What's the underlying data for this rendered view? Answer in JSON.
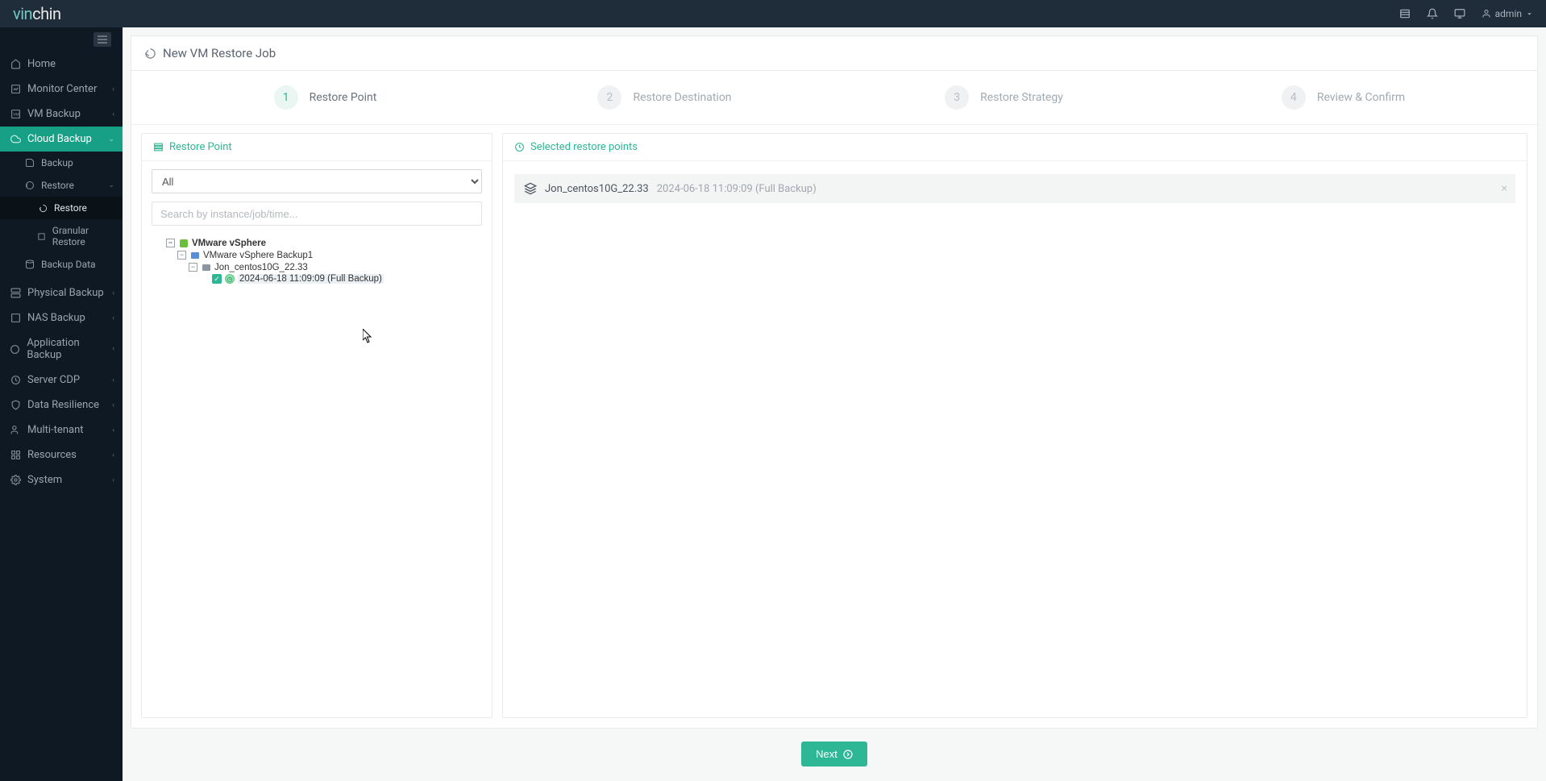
{
  "brand": {
    "p1": "vin",
    "p2": "chin"
  },
  "user": {
    "name": "admin"
  },
  "nav": {
    "home": "Home",
    "monitor": "Monitor Center",
    "vmbackup": "VM Backup",
    "cloudbackup": "Cloud Backup",
    "backup": "Backup",
    "restore": "Restore",
    "restore2": "Restore",
    "granular": "Granular Restore",
    "backupdata": "Backup Data",
    "physical": "Physical Backup",
    "nas": "NAS Backup",
    "app": "Application Backup",
    "cdp": "Server CDP",
    "resilience": "Data Resilience",
    "multitenant": "Multi-tenant",
    "resources": "Resources",
    "system": "System"
  },
  "page": {
    "title": "New VM Restore Job"
  },
  "steps": [
    {
      "num": "1",
      "label": "Restore Point"
    },
    {
      "num": "2",
      "label": "Restore Destination"
    },
    {
      "num": "3",
      "label": "Restore Strategy"
    },
    {
      "num": "4",
      "label": "Review & Confirm"
    }
  ],
  "left_panel": {
    "title": "Restore Point",
    "filter": "All",
    "search_placeholder": "Search by instance/job/time...",
    "tree": {
      "root": "VMware vSphere",
      "job": "VMware vSphere Backup1",
      "vm": "Jon_centos10G_22.33",
      "point": "2024-06-18 11:09:09 (Full  Backup)"
    }
  },
  "right_panel": {
    "title": "Selected restore points",
    "item": {
      "name": "Jon_centos10G_22.33",
      "meta": "2024-06-18 11:09:09 (Full Backup)"
    }
  },
  "footer": {
    "next": "Next"
  }
}
